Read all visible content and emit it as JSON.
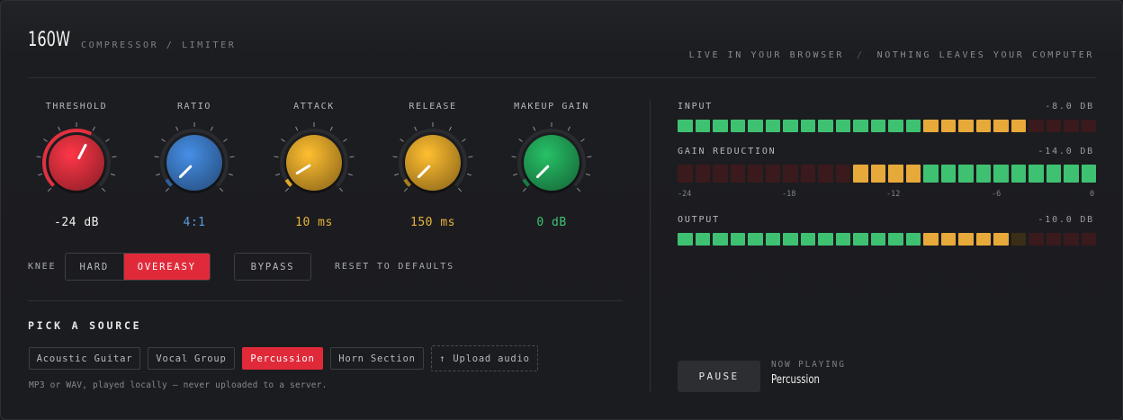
{
  "header": {
    "title": "160W",
    "subtitle": "COMPRESSOR / LIMITER",
    "tagline_left": "LIVE IN YOUR BROWSER",
    "tagline_sep": "/",
    "tagline_right": "NOTHING LEAVES YOUR COMPUTER"
  },
  "knobs": [
    {
      "label": "THRESHOLD",
      "value": "-24 dB",
      "color": "#e2303f",
      "value_color": "#f0f0f0",
      "position": 0.6
    },
    {
      "label": "RATIO",
      "value": "4:1",
      "color": "#3d7cc9",
      "value_color": "#5b9be0",
      "position": 0.0
    },
    {
      "label": "ATTACK",
      "value": "10 ms",
      "color": "#e2a62a",
      "value_color": "#e8b33a",
      "position": 0.05
    },
    {
      "label": "RELEASE",
      "value": "150 ms",
      "color": "#e2a62a",
      "value_color": "#e8b33a",
      "position": 0.0
    },
    {
      "label": "MAKEUP GAIN",
      "value": "0 dB",
      "color": "#22a85a",
      "value_color": "#3cc574",
      "position": 0.0
    }
  ],
  "controls": {
    "knee_label": "KNEE",
    "knee_options": [
      "HARD",
      "OVEREASY"
    ],
    "knee_selected": "OVEREASY",
    "bypass_label": "BYPASS",
    "reset_label": "RESET TO DEFAULTS"
  },
  "source": {
    "heading": "PICK A SOURCE",
    "options": [
      "Acoustic Guitar",
      "Vocal Group",
      "Percussion",
      "Horn Section"
    ],
    "selected": "Percussion",
    "upload_label": "Upload audio",
    "note": "MP3 or WAV, played locally — never uploaded to a server."
  },
  "meters": {
    "input": {
      "label": "INPUT",
      "value": "-8.0 DB",
      "segments": 24,
      "lit": 20
    },
    "gain_reduction": {
      "label": "GAIN REDUCTION",
      "value": "-14.0 DB",
      "segments": 24,
      "lit": 14
    },
    "scale": [
      "-24",
      "-18",
      "-12",
      "-6",
      "0"
    ],
    "output": {
      "label": "OUTPUT",
      "value": "-10.0 DB",
      "segments": 24,
      "lit": 19
    }
  },
  "transport": {
    "pause_label": "PAUSE",
    "now_playing_label": "NOW PLAYING",
    "now_playing_value": "Percussion"
  },
  "colors": {
    "green": "#3fc172",
    "amber": "#e7a93a",
    "red_dim": "#3a1a1c",
    "amber_dim": "#3a2e16",
    "accent_red": "#e02a3a"
  }
}
